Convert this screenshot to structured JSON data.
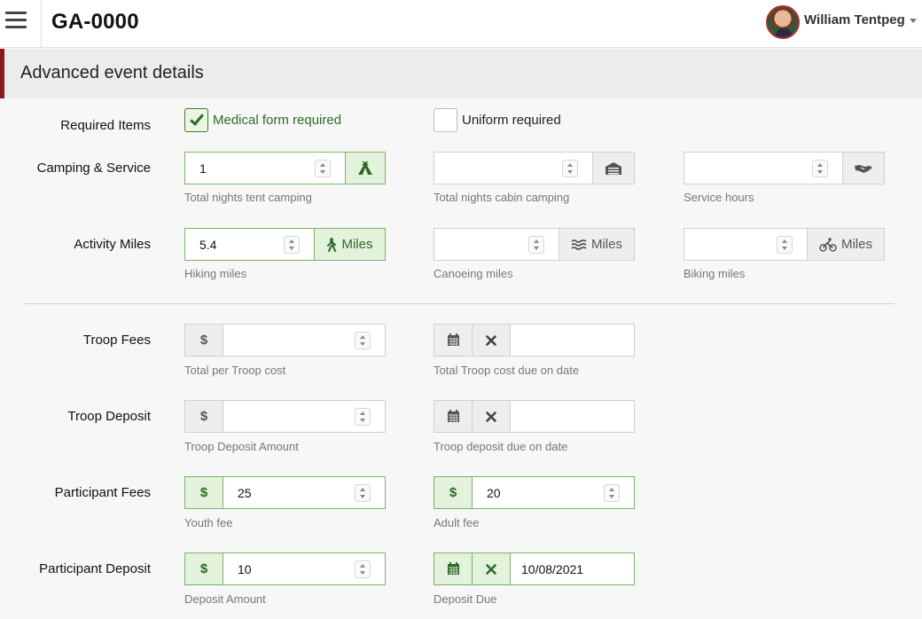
{
  "header": {
    "app_title": "GA-0000",
    "user_name": "William Tentpeg"
  },
  "section": {
    "title": "Advanced event details"
  },
  "required_items": {
    "label": "Required Items",
    "medical": {
      "label": "Medical form required",
      "checked": true
    },
    "uniform": {
      "label": "Uniform required",
      "checked": false
    }
  },
  "camping": {
    "label": "Camping & Service",
    "tent": {
      "value": "1",
      "help": "Total nights tent camping",
      "icon": "tent-icon"
    },
    "cabin": {
      "value": "",
      "help": "Total nights cabin camping",
      "icon": "cabin-icon"
    },
    "service": {
      "value": "",
      "help": "Service hours",
      "icon": "handshake-icon"
    }
  },
  "miles": {
    "label": "Activity Miles",
    "unit": "Miles",
    "hiking": {
      "value": "5.4",
      "help": "Hiking miles",
      "icon": "hiker-icon"
    },
    "canoeing": {
      "value": "",
      "help": "Canoeing miles",
      "icon": "water-icon"
    },
    "biking": {
      "value": "",
      "help": "Biking miles",
      "icon": "bike-icon"
    }
  },
  "troop_fees": {
    "label": "Troop Fees",
    "currency": "$",
    "amount": {
      "value": "",
      "help": "Total per Troop cost"
    },
    "due": {
      "value": "",
      "help": "Total Troop cost due on date"
    }
  },
  "troop_deposit": {
    "label": "Troop Deposit",
    "currency": "$",
    "amount": {
      "value": "",
      "help": "Troop Deposit Amount"
    },
    "due": {
      "value": "",
      "help": "Troop deposit due on date"
    }
  },
  "participant_fees": {
    "label": "Participant Fees",
    "currency": "$",
    "youth": {
      "value": "25",
      "help": "Youth fee"
    },
    "adult": {
      "value": "20",
      "help": "Adult fee"
    }
  },
  "participant_deposit": {
    "label": "Participant Deposit",
    "currency": "$",
    "amount": {
      "value": "10",
      "help": "Deposit Amount"
    },
    "due": {
      "value": "10/08/2021",
      "help": "Deposit Due"
    }
  },
  "colors": {
    "accent_bar": "#8b1a1a",
    "active_green": "#2f6a28",
    "active_bg": "#e3f2da"
  }
}
